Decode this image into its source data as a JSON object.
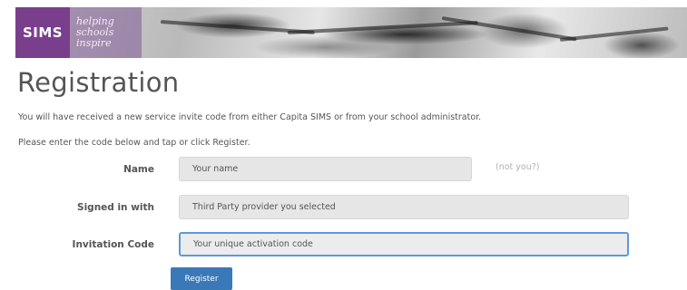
{
  "banner": {
    "brand": "SIMS",
    "tagline": [
      "helping",
      "schools",
      "inspire"
    ]
  },
  "page": {
    "title": "Registration",
    "intro_1": "You will have received a new service invite code from either Capita SIMS or from your school administrator.",
    "intro_2": "Please enter the code below and tap or click Register."
  },
  "form": {
    "name_label": "Name",
    "name_value": "Your name",
    "not_you_link": "(not you?)",
    "signed_in_label": "Signed in with",
    "signed_in_value": "Third Party provider you selected",
    "code_label": "Invitation Code",
    "code_placeholder": "Your unique activation code",
    "register_button": "Register"
  }
}
